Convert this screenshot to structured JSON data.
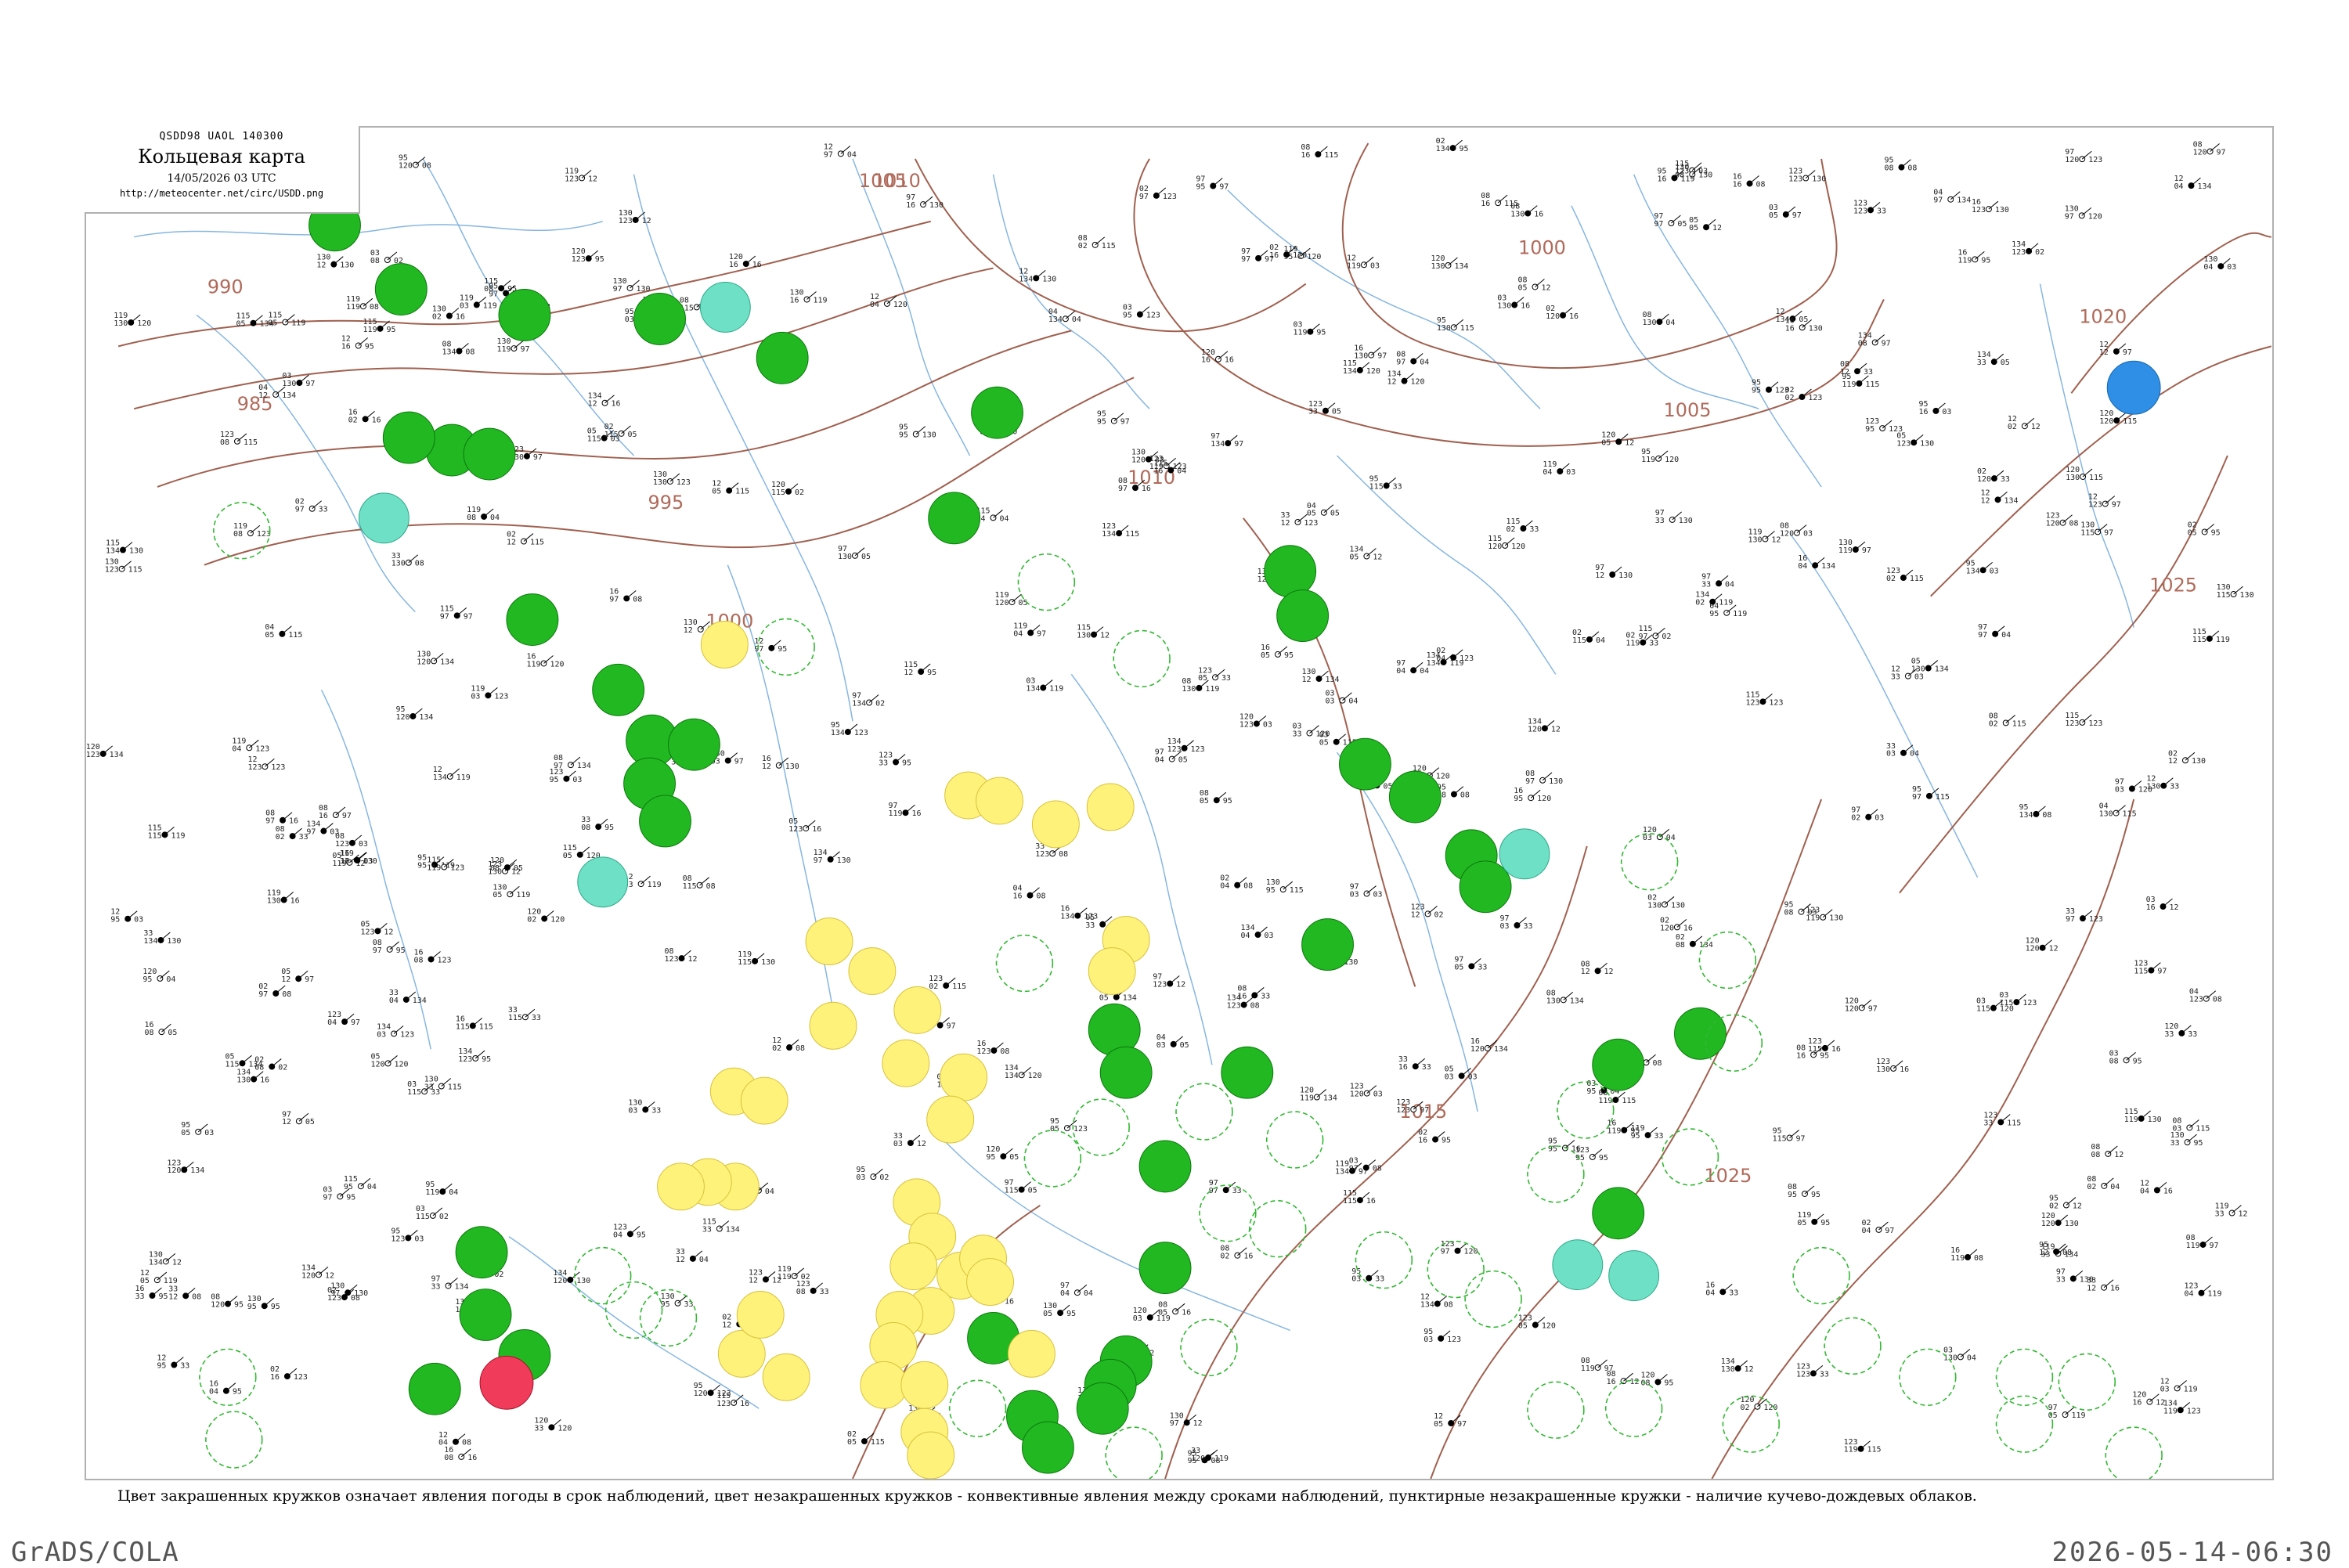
{
  "header": {
    "code": "QSDD98  UAOL  140300",
    "title": "Кольцевая карта",
    "datetime": "14/05/2026 03 UTC",
    "url": "http://meteocenter.net/circ/USDD.png"
  },
  "legend_caption": "Цвет закрашенных кружков означает явления погоды в срок наблюдений, цвет незакрашенных кружков - конвективные явления между сроками наблюдений, пунктирные незакрашенные кружки - наличие кучево-дождевых облаков.",
  "footer": {
    "left": "GrADS/COLA",
    "right": "2026-05-14-06:30"
  },
  "colors": {
    "isobar": "#a0604f",
    "river": "#86b6e0",
    "rain": "#22b822",
    "rain_dashed": "#32b832",
    "shower": "#fff27a",
    "fog": "#6ee0c6",
    "thunder": "#f03c5a",
    "snow": "#2f8fe6"
  },
  "isobar_labels": [
    "1005",
    "1010",
    "1000",
    "1005",
    "1010",
    "1020",
    "990",
    "985",
    "995",
    "1000",
    "1015",
    "1025",
    "1025"
  ],
  "station_samples": [
    "95",
    "97",
    "04",
    "02",
    "03",
    "08",
    "12",
    "16",
    "33",
    "05",
    "120",
    "119",
    "123",
    "130",
    "134",
    "115"
  ],
  "weather_symbols": [
    {
      "type": "rain",
      "count": 41
    },
    {
      "type": "shower",
      "count": 36
    },
    {
      "type": "fog",
      "count": 6
    },
    {
      "type": "thunder",
      "count": 1
    },
    {
      "type": "snow",
      "count": 1
    }
  ]
}
